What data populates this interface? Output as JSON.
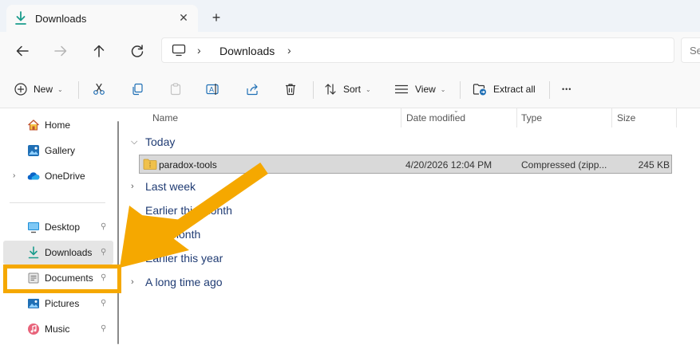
{
  "tab": {
    "title": "Downloads",
    "close_glyph": "✕",
    "new_tab_glyph": "+"
  },
  "address": {
    "crumbs": [
      "Downloads"
    ],
    "separator": "›",
    "search_placeholder": "Se"
  },
  "toolbar": {
    "new_label": "New",
    "sort_label": "Sort",
    "view_label": "View",
    "extract_label": "Extract all",
    "more_glyph": "•••",
    "chevron": "⌄"
  },
  "sidebar": {
    "items": [
      {
        "label": "Home",
        "icon": "home-icon",
        "pinned": false,
        "expander": false
      },
      {
        "label": "Gallery",
        "icon": "gallery-icon",
        "pinned": false,
        "expander": false
      },
      {
        "label": "OneDrive",
        "icon": "onedrive-icon",
        "pinned": false,
        "expander": true
      },
      {
        "label": "Desktop",
        "icon": "desktop-icon",
        "pinned": true
      },
      {
        "label": "Downloads",
        "icon": "downloads-icon",
        "pinned": true,
        "selected": true
      },
      {
        "label": "Documents",
        "icon": "documents-icon",
        "pinned": true
      },
      {
        "label": "Pictures",
        "icon": "pictures-icon",
        "pinned": true
      },
      {
        "label": "Music",
        "icon": "music-icon",
        "pinned": true
      }
    ],
    "pin_glyph": "📌",
    "expander_glyph": "›"
  },
  "columns": {
    "name": "Name",
    "date": "Date modified",
    "type": "Type",
    "size": "Size"
  },
  "groups": [
    {
      "label": "Today",
      "expanded": true
    },
    {
      "label": "Last week",
      "expanded": false
    },
    {
      "label": "Earlier this month",
      "expanded": false
    },
    {
      "label": "Last month",
      "expanded": false
    },
    {
      "label": "Earlier this year",
      "expanded": false
    },
    {
      "label": "A long time ago",
      "expanded": false
    }
  ],
  "files": [
    {
      "name": "paradox-tools",
      "date": "4/20/2026 12:04 PM",
      "type": "Compressed (zipp...",
      "size": "245 KB",
      "selected": true
    }
  ],
  "colors": {
    "accent": "#0078d4",
    "arrow": "#f5a800",
    "group_text": "#1f3b73",
    "selected_row": "#d9d9d9"
  }
}
